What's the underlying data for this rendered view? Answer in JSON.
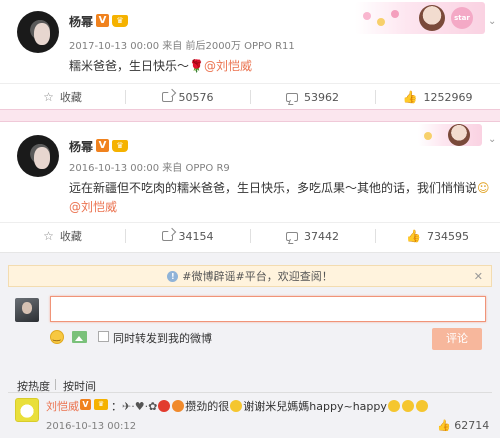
{
  "post1": {
    "author": "杨幂",
    "meta": "2017-10-13 00:00 来自 前后2000万 OPPO R11",
    "text_prefix": "糯米爸爸，生日快乐～",
    "mention": "@刘恺威",
    "actions": {
      "favorite": "收藏",
      "repost": "50576",
      "comment": "53962",
      "like": "1252969"
    }
  },
  "post2": {
    "author": "杨幂",
    "meta": "2016-10-13 00:00 来自 OPPO R9",
    "text": "远在新疆但不吃肉的糯米爸爸，生日快乐，多吃瓜果～其他的话，我们悄悄说",
    "mention": "@刘恺威",
    "actions": {
      "favorite": "收藏",
      "repost": "34154",
      "comment": "37442",
      "like": "734595"
    }
  },
  "notice": {
    "text": "#微博辟谣#平台，欢迎查阅！",
    "close": "✕"
  },
  "composer": {
    "input_value": "",
    "checkbox_label": "同时转发到我的微博",
    "submit": "评论"
  },
  "sort": {
    "hot": "按热度",
    "time": "按时间"
  },
  "comment": {
    "author": "刘恺威",
    "text_a": "：",
    "text_b": "攒劲的很",
    "text_c": "谢谢米兒媽媽happy~happy",
    "date": "2016-10-13 00:12",
    "likes": "62714"
  },
  "colors": {
    "accent": "#eb7350",
    "vip": "#f0821e",
    "divider": "#fbe6ee"
  }
}
